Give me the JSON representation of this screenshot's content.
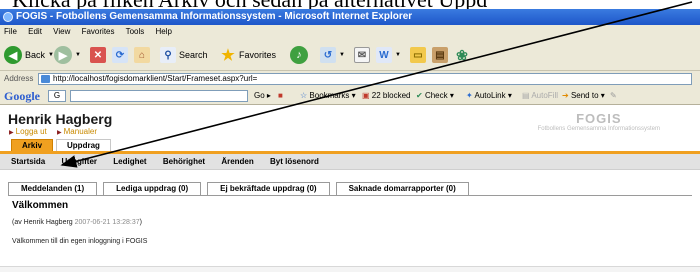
{
  "caption": "Klicka på fliken Arkiv och sedan på alternativet Uppd",
  "window": {
    "title": "FOGIS - Fotbollens Gemensamma Informationssystem - Microsoft Internet Explorer"
  },
  "menu": [
    "File",
    "Edit",
    "View",
    "Favorites",
    "Tools",
    "Help"
  ],
  "toolbar": {
    "back": "Back",
    "search": "Search",
    "favorites": "Favorites"
  },
  "address": {
    "label": "Address",
    "url": "http://localhost/fogisdomarklient/Start/Frameset.aspx?url="
  },
  "google_toolbar": {
    "logo": "Google",
    "combo": "G",
    "go": "Go",
    "bookmarks": "Bookmarks",
    "blocked": "22 blocked",
    "check": "Check",
    "autolink": "AutoLink",
    "autofill": "AutoFill",
    "sendto": "Send to"
  },
  "page": {
    "user_name": "Henrik Hagberg",
    "links": [
      "Logga ut",
      "Manualer"
    ],
    "brand_title": "FOGIS",
    "brand_subtitle": "Fotbollens Gemensamma Informationssystem",
    "main_tabs": [
      "Arkiv",
      "Uppdrag"
    ],
    "subnav": [
      "Startsida",
      "Uppgifter",
      "Ledighet",
      "Behörighet",
      "Ärenden",
      "Byt lösenord"
    ],
    "info_tabs": [
      "Meddelanden (1)",
      "Lediga uppdrag (0)",
      "Ej bekräftade uppdrag (0)",
      "Saknade domarrapporter (0)"
    ],
    "welcome": "Välkommen",
    "meta_prefix": "(av Henrik Hagberg ",
    "meta_date": "2007-06-21 13:28:37",
    "meta_suffix": ")",
    "message": "Välkommen till din egen inloggning i FOGIS"
  },
  "colors": {
    "accent": "#f0a020",
    "titlebar": "#1e56c9",
    "chrome": "#ece9d8"
  }
}
